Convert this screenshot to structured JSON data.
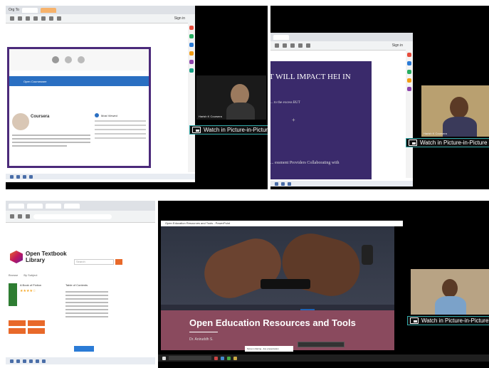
{
  "pip": {
    "label": "Watch in Picture-in-Picture"
  },
  "panel_tl": {
    "browser": {
      "tab_label": "Org To",
      "sign_in": "Sign in"
    },
    "page": {
      "heading": "Coursera",
      "banner_text": "Open Courseware",
      "list_title": "Most Viewed"
    },
    "webcam_name": "Harish K Coursera"
  },
  "panel_tr": {
    "browser": {
      "sign_in": "Sign in"
    },
    "slide": {
      "line1": "T WILL IMPACT HEI IN",
      "line2": "... to the excess BUT",
      "line3": "... essment Providers Collaborating with"
    },
    "webcam_name": "Harish K Coursera"
  },
  "panel_bl": {
    "site": {
      "logo_title": "Open Textbook",
      "logo_subtitle": "Library",
      "nav_browse": "Browse",
      "nav_about": "By Subject",
      "book_title": "A Book of Fiction",
      "toc_title": "Table of Contents",
      "search_placeholder": "Search"
    }
  },
  "panel_br": {
    "window_title": "Open Education Resources and Tools - PowerPoint",
    "slide": {
      "title": "Open Education Resources and Tools",
      "subtitle": "Dr. Aniruddh S."
    },
    "caption_bar": "Screen sharing - live presentation"
  },
  "colors": {
    "slide_purple": "#3a2a6b",
    "ppt_maroon": "#8a4a5e",
    "sidebar_accent": "#2b7bd6",
    "otl_orange": "#e8692a"
  }
}
